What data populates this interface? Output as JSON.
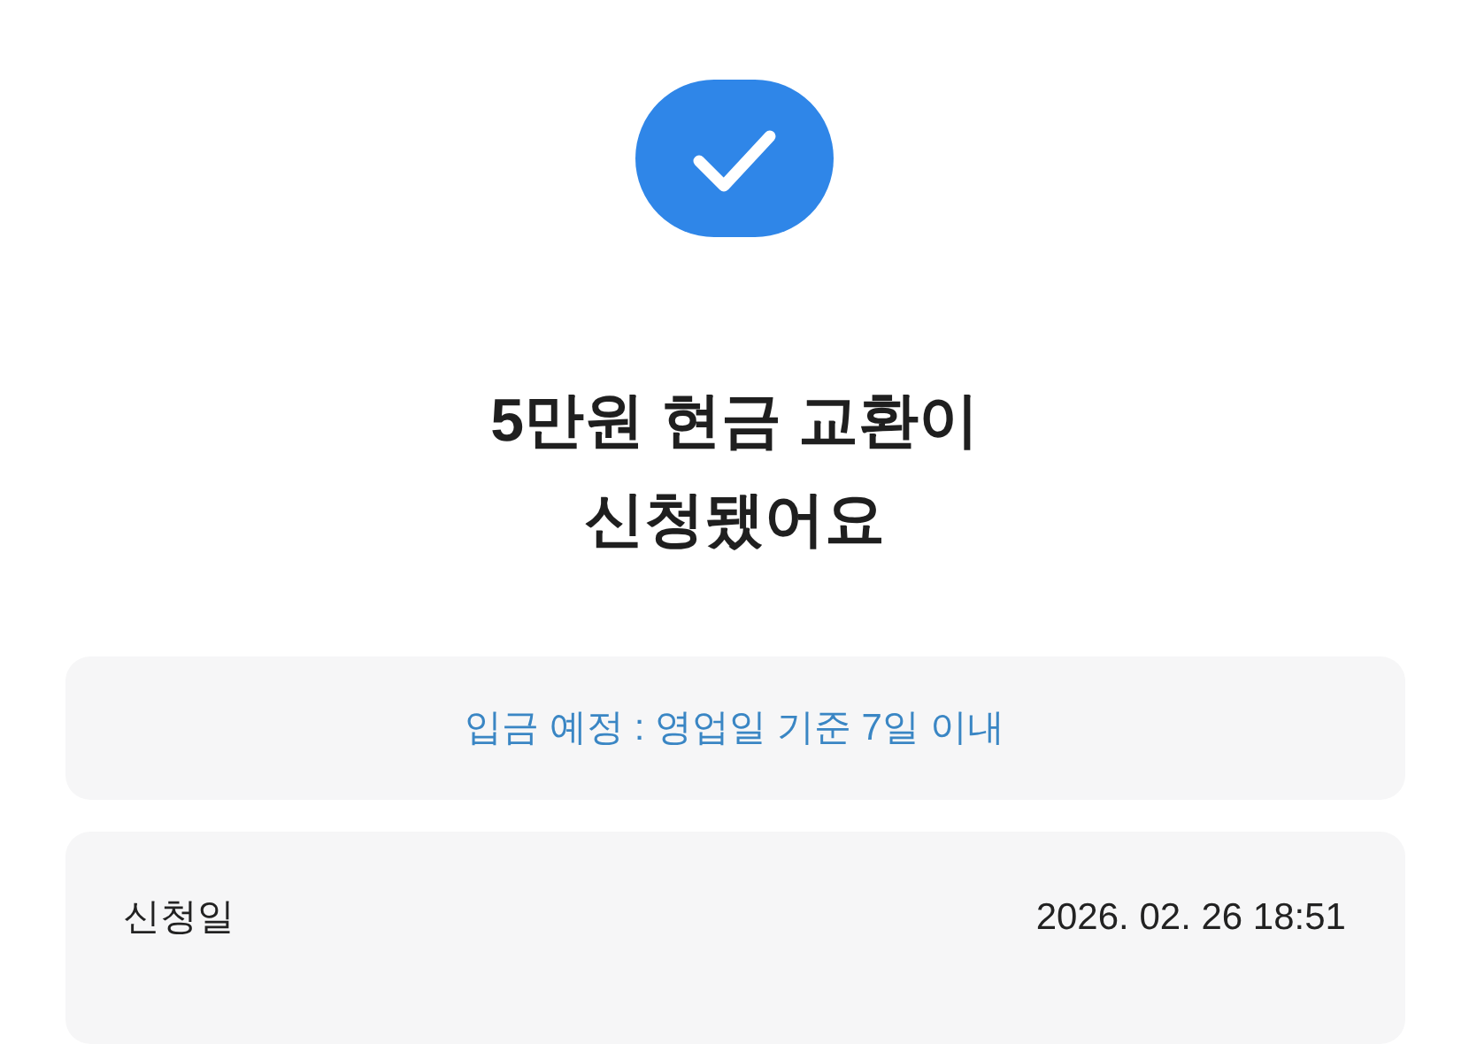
{
  "title_lines": [
    "5만원 현금 교환이",
    "신청됐어요"
  ],
  "notice": "입금 예정 : 영업일 기준 7일 이내",
  "details": [
    {
      "label": "신청일",
      "value": "2026. 02. 26 18:51"
    }
  ]
}
